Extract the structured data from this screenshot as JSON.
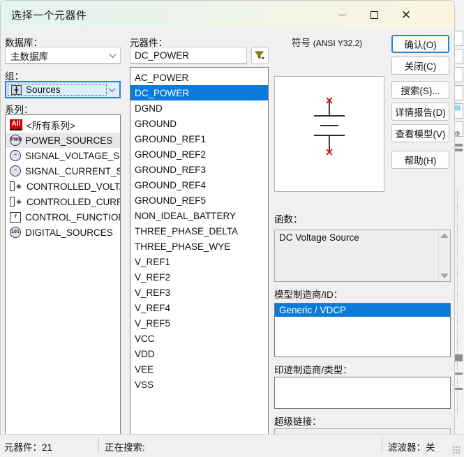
{
  "window": {
    "title": "选择一个元器件",
    "minimize_label": "最小化",
    "maximize_label": "最大化",
    "close_label": "关闭"
  },
  "left_panel": {
    "database_label": "数据库：",
    "database_value": "主数据库",
    "group_label": "组：",
    "group_value": "Sources",
    "group_icon": "sources-icon",
    "family_label": "系列：",
    "family_items": [
      {
        "label": "<所有系列>",
        "icon": "all-icon",
        "icon_text": "All",
        "selected": false
      },
      {
        "label": "POWER_SOURCES",
        "icon": "power-sources-icon",
        "icon_text": "PWR",
        "selected": true
      },
      {
        "label": "SIGNAL_VOLTAGE_SOU",
        "icon": "signal-voltage-source-icon",
        "icon_text": "~",
        "selected": false
      },
      {
        "label": "SIGNAL_CURRENT_SOU",
        "icon": "signal-current-source-icon",
        "icon_text": "~",
        "selected": false
      },
      {
        "label": "CONTROLLED_VOLTAGE",
        "icon": "controlled-voltage-icon",
        "icon_text": "",
        "selected": false
      },
      {
        "label": "CONTROLLED_CURRENT",
        "icon": "controlled-current-icon",
        "icon_text": "",
        "selected": false
      },
      {
        "label": "CONTROL_FUNCTION_B",
        "icon": "control-function-block-icon",
        "icon_text": "f",
        "selected": false
      },
      {
        "label": "DIGITAL_SOURCES",
        "icon": "digital-sources-icon",
        "icon_text": "101",
        "selected": false
      }
    ]
  },
  "component_panel": {
    "label": "元器件：",
    "search_value": "DC_POWER",
    "search_placeholder": "",
    "filter_icon": "filter-icon",
    "items": [
      {
        "label": "AC_POWER",
        "selected": false
      },
      {
        "label": "DC_POWER",
        "selected": true
      },
      {
        "label": "DGND",
        "selected": false
      },
      {
        "label": "GROUND",
        "selected": false
      },
      {
        "label": "GROUND_REF1",
        "selected": false
      },
      {
        "label": "GROUND_REF2",
        "selected": false
      },
      {
        "label": "GROUND_REF3",
        "selected": false
      },
      {
        "label": "GROUND_REF4",
        "selected": false
      },
      {
        "label": "GROUND_REF5",
        "selected": false
      },
      {
        "label": "NON_IDEAL_BATTERY",
        "selected": false
      },
      {
        "label": "THREE_PHASE_DELTA",
        "selected": false
      },
      {
        "label": "THREE_PHASE_WYE",
        "selected": false
      },
      {
        "label": "V_REF1",
        "selected": false
      },
      {
        "label": "V_REF2",
        "selected": false
      },
      {
        "label": "V_REF3",
        "selected": false
      },
      {
        "label": "V_REF4",
        "selected": false
      },
      {
        "label": "V_REF5",
        "selected": false
      },
      {
        "label": "VCC",
        "selected": false
      },
      {
        "label": "VDD",
        "selected": false
      },
      {
        "label": "VEE",
        "selected": false
      },
      {
        "label": "VSS",
        "selected": false
      }
    ]
  },
  "symbol_panel": {
    "title_main": "符号",
    "title_standard": "(ANSI Y32.2)",
    "symbol_icon": "dc-power-symbol"
  },
  "buttons": [
    {
      "name": "confirm-button",
      "label": "确认(O)",
      "default": true
    },
    {
      "name": "close-button",
      "label": "关闭(C)",
      "default": false
    },
    {
      "name": "search-button",
      "label": "搜索(S)...",
      "default": false
    },
    {
      "name": "detail-report-button",
      "label": "详情报告(D)",
      "default": false
    },
    {
      "name": "view-model-button",
      "label": "查看模型(V)",
      "default": false
    },
    {
      "name": "help-button",
      "label": "帮助(H)",
      "default": false
    }
  ],
  "details": {
    "function_label": "函数：",
    "function_value": "DC Voltage Source",
    "model_maker_label": "模型制造商/ID：",
    "model_maker_value": "Generic / VDCP",
    "footprint_label": "印迹制造商/类型：",
    "footprint_value": "",
    "hyperlink_label": "超级链接：",
    "hyperlink_value": ""
  },
  "statusbar": {
    "component_count_label": "元器件：21",
    "searching_label": "正在搜索:",
    "filter_label": "滤波器：关",
    "grip_icon": "resize-grip-icon"
  },
  "colors": {
    "accent": "#0a7bd8",
    "focus_border": "#2a80d2",
    "title_gradient_start": "#e4f4ee",
    "title_gradient_end": "#fbf5df",
    "symbol_terminal": "#d10000",
    "all_icon_bg": "#cf0000",
    "filter_icon": "#857d00"
  }
}
